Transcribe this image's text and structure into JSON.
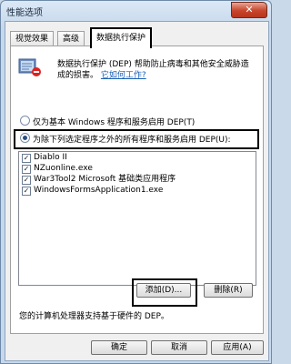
{
  "window": {
    "title": "性能选项",
    "close_label": "✕"
  },
  "tabs": [
    {
      "label": "视觉效果"
    },
    {
      "label": "高级"
    },
    {
      "label": "数据执行保护"
    }
  ],
  "dep": {
    "icon": "dep-shield-icon",
    "description_pre": "数据执行保护 (DEP) 帮助防止病毒和其他安全威胁造成的损害。",
    "link": "它如何工作?"
  },
  "radio_options": [
    {
      "label": "仅为基本 Windows 程序和服务启用 DEP(T)",
      "selected": false
    },
    {
      "label": "为除下列选定程序之外的所有程序和服务启用 DEP(U):",
      "selected": true
    }
  ],
  "programs": [
    {
      "name": "Diablo II",
      "checked": true
    },
    {
      "name": "NZuonline.exe",
      "checked": true
    },
    {
      "name": "War3Tool2 Microsoft 基础类应用程序",
      "checked": true
    },
    {
      "name": "WindowsFormsApplication1.exe",
      "checked": true
    }
  ],
  "buttons": {
    "add": "添加(D)...",
    "remove": "删除(R)",
    "ok": "确定",
    "cancel": "取消",
    "apply": "应用(A)"
  },
  "status_note": "您的计算机处理器支持基于硬件的 DEP。",
  "colors": {
    "selection_highlight": "#000000",
    "link": "#1a5fb4"
  }
}
